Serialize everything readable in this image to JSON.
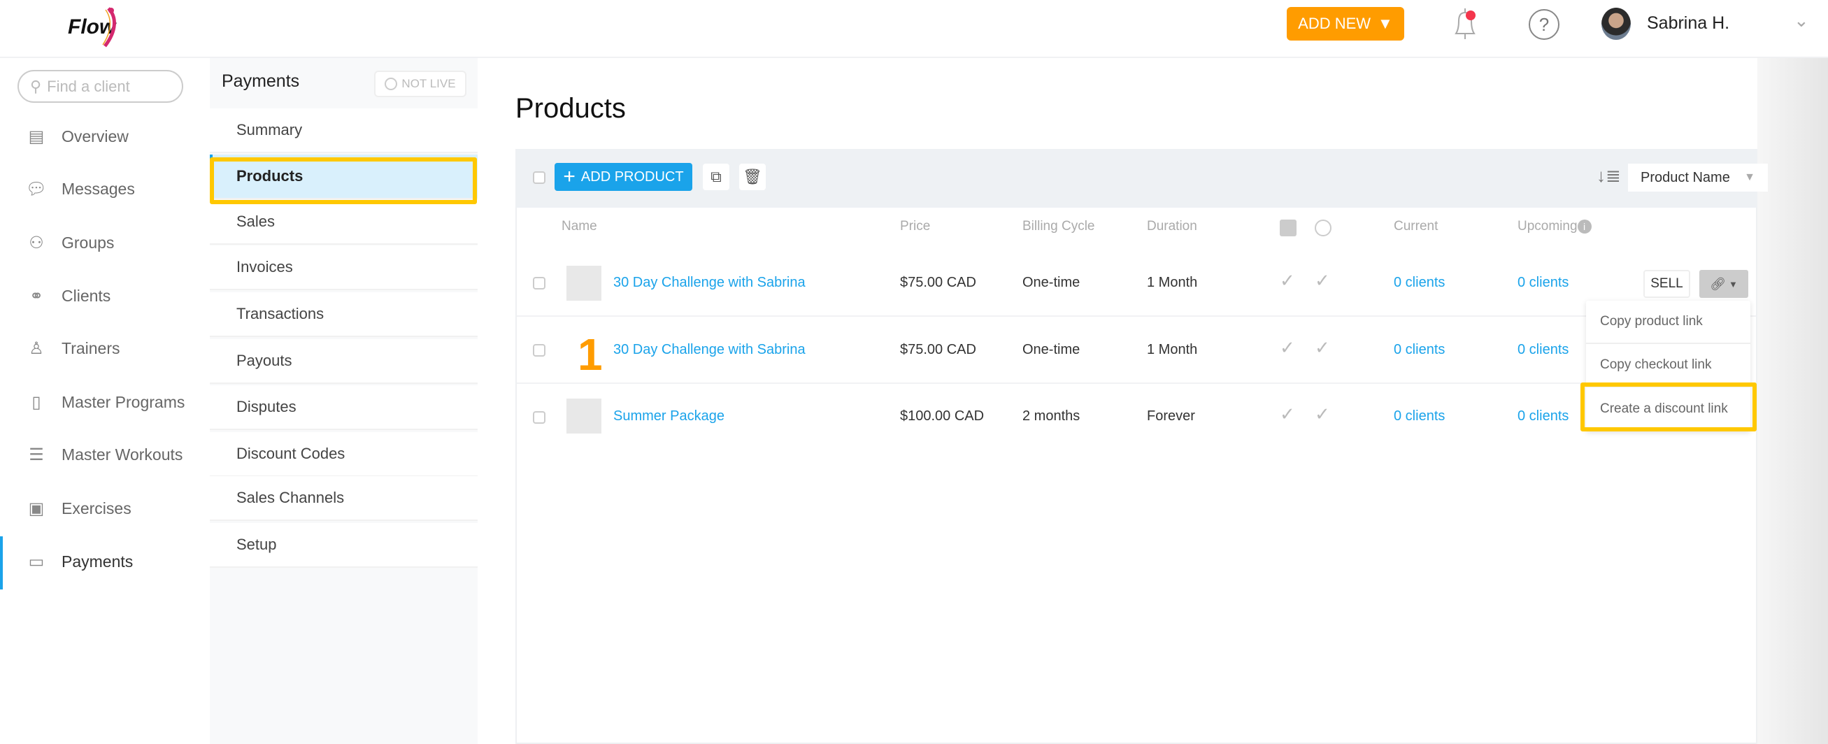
{
  "header": {
    "logo_text": "Flow",
    "add_new_label": "ADD NEW",
    "user_name": "Sabrina H.",
    "brand_color": "#ff9c00",
    "accent_color": "#1aa3ea",
    "notification_dot": true
  },
  "sidebar": {
    "search_placeholder": "Find a client",
    "items": [
      {
        "label": "Overview",
        "icon": "overview-icon"
      },
      {
        "label": "Messages",
        "icon": "messages-icon"
      },
      {
        "label": "Groups",
        "icon": "groups-icon"
      },
      {
        "label": "Clients",
        "icon": "clients-icon"
      },
      {
        "label": "Trainers",
        "icon": "trainers-icon"
      },
      {
        "label": "Master Programs",
        "icon": "programs-icon"
      },
      {
        "label": "Master Workouts",
        "icon": "workouts-icon"
      },
      {
        "label": "Exercises",
        "icon": "exercises-icon"
      },
      {
        "label": "Payments",
        "icon": "payments-icon",
        "active": true
      }
    ]
  },
  "subnav": {
    "title": "Payments",
    "status": "NOT LIVE",
    "items": [
      {
        "label": "Summary"
      },
      {
        "label": "Products",
        "active": true
      },
      {
        "label": "Sales"
      },
      {
        "label": "Invoices"
      },
      {
        "label": "Transactions"
      },
      {
        "label": "Payouts"
      },
      {
        "label": "Disputes"
      },
      {
        "label": "Discount Codes"
      },
      {
        "label": "Sales Channels"
      },
      {
        "label": "Setup"
      }
    ]
  },
  "main": {
    "title": "Products",
    "toolbar": {
      "add_product_label": "ADD PRODUCT",
      "sort_value": "Product Name"
    },
    "columns": {
      "name": "Name",
      "price": "Price",
      "billing": "Billing Cycle",
      "duration": "Duration",
      "current": "Current",
      "upcoming": "Upcoming"
    },
    "rows": [
      {
        "name": "30 Day Challenge with Sabrina",
        "price": "$75.00 CAD",
        "billing": "One-time",
        "duration": "1 Month",
        "current": "0 clients",
        "upcoming": "0 clients"
      },
      {
        "name": "30 Day Challenge with Sabrina",
        "price": "$75.00 CAD",
        "billing": "One-time",
        "duration": "1 Month",
        "current": "0 clients",
        "upcoming": "0 clients"
      },
      {
        "name": "Summer Package",
        "price": "$100.00 CAD",
        "billing": "2 months",
        "duration": "Forever",
        "current": "0 clients",
        "upcoming": "0 clients"
      }
    ],
    "sell_label": "SELL",
    "link_menu": [
      "Copy product link",
      "Copy checkout link",
      "Create a discount link"
    ],
    "annotation": "1"
  }
}
